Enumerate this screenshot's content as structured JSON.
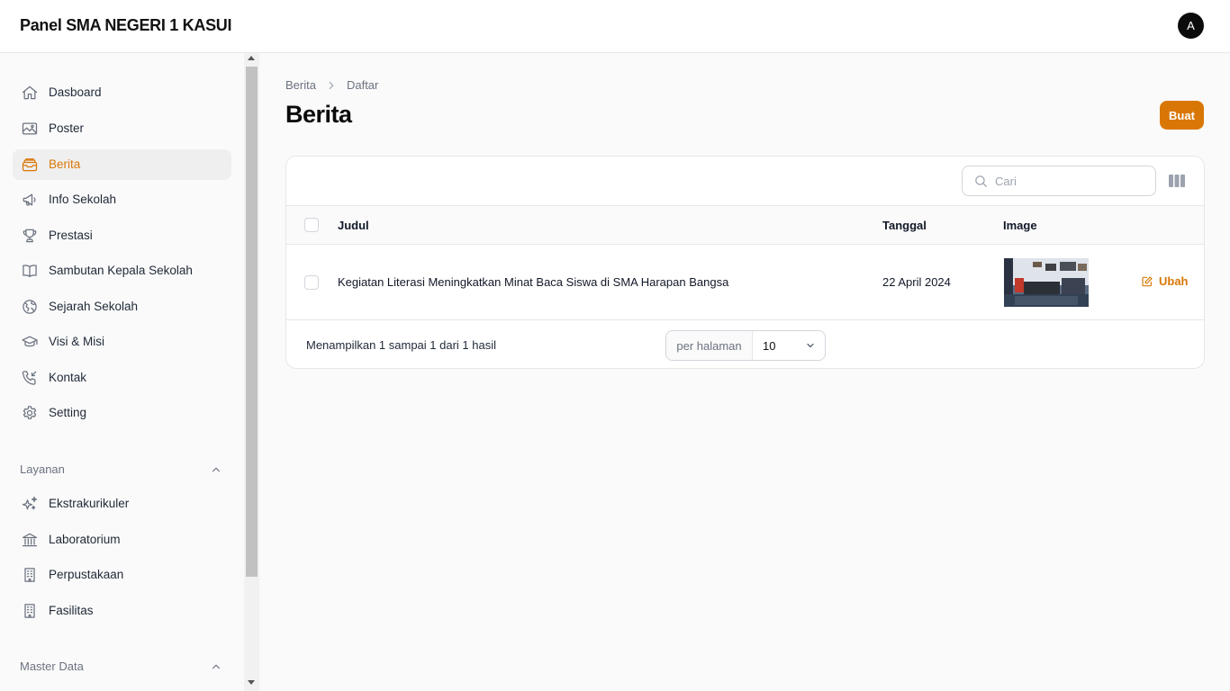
{
  "app": {
    "title": "Panel SMA NEGERI 1 KASUI",
    "user_initial": "A"
  },
  "colors": {
    "accent": "#d97706"
  },
  "sidebar": {
    "items": [
      {
        "label": "Dasboard",
        "icon": "home-icon"
      },
      {
        "label": "Poster",
        "icon": "image-icon"
      },
      {
        "label": "Berita",
        "icon": "inbox-stack-icon",
        "active": true
      },
      {
        "label": "Info Sekolah",
        "icon": "megaphone-icon"
      },
      {
        "label": "Prestasi",
        "icon": "trophy-icon"
      },
      {
        "label": "Sambutan Kepala Sekolah",
        "icon": "book-open-icon"
      },
      {
        "label": "Sejarah Sekolah",
        "icon": "globe-icon"
      },
      {
        "label": "Visi & Misi",
        "icon": "academic-cap-icon"
      },
      {
        "label": "Kontak",
        "icon": "phone-icon"
      },
      {
        "label": "Setting",
        "icon": "gear-icon"
      }
    ],
    "groups": [
      {
        "label": "Layanan",
        "items": [
          {
            "label": "Ekstrakurikuler",
            "icon": "sparkles-icon"
          },
          {
            "label": "Laboratorium",
            "icon": "building-library-icon"
          },
          {
            "label": "Perpustakaan",
            "icon": "office-building-icon"
          },
          {
            "label": "Fasilitas",
            "icon": "office-building-icon"
          }
        ]
      },
      {
        "label": "Master Data",
        "items": []
      }
    ]
  },
  "page": {
    "breadcrumb": [
      "Berita",
      "Daftar"
    ],
    "title": "Berita",
    "create_label": "Buat"
  },
  "table": {
    "search_placeholder": "Cari",
    "columns": [
      "Judul",
      "Tanggal",
      "Image"
    ],
    "rows": [
      {
        "judul": "Kegiatan Literasi Meningkatkan Minat Baca Siswa di SMA Harapan Bangsa",
        "tanggal": "22 April 2024",
        "action_label": "Ubah"
      }
    ],
    "summary": "Menampilkan 1 sampai 1 dari 1 hasil",
    "per_page_label": "per halaman",
    "per_page_value": "10"
  }
}
